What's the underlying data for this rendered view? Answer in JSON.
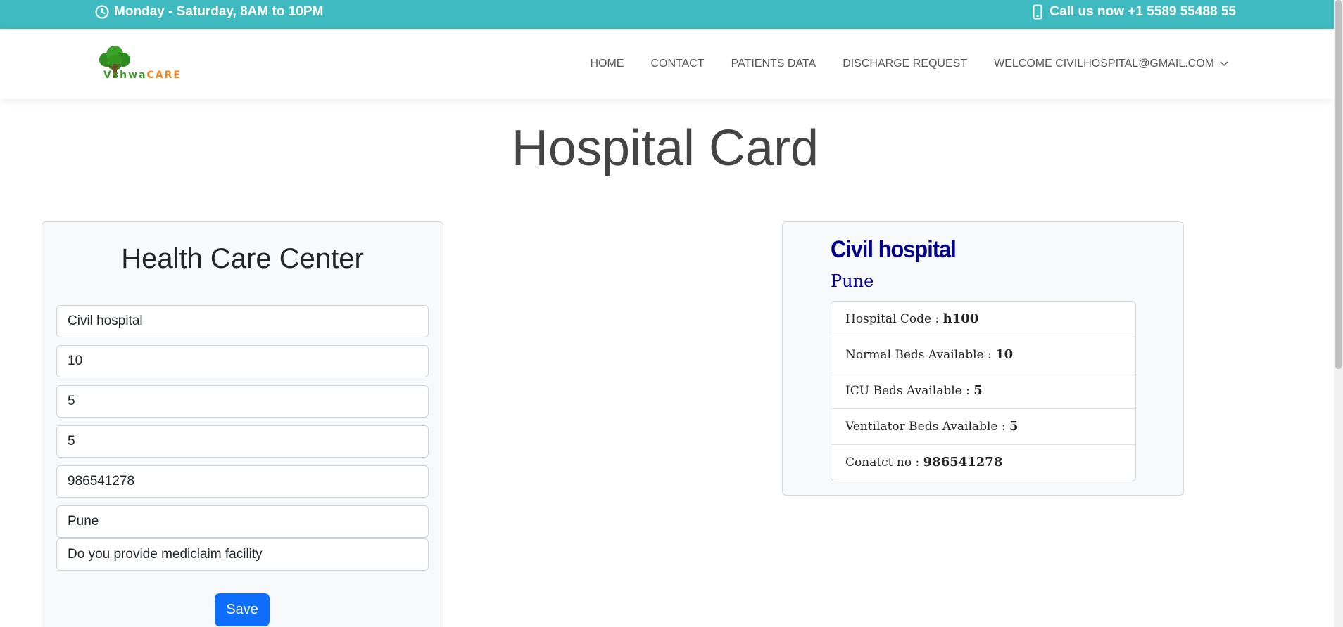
{
  "topbar": {
    "hours_text": "Monday - Saturday, 8AM to 10PM",
    "call_text": "Call us now +1 5589 55488 55",
    "icons": [
      "clock-icon",
      "phone-icon"
    ]
  },
  "brand": {
    "logo_letter": "V",
    "logo_text_middle": "shwa",
    "logo_text_end": "CARE"
  },
  "nav": {
    "home": "HOME",
    "contact": "CONTACT",
    "patients": "PATIENTS DATA",
    "discharge": "DISCHARGE REQUEST",
    "welcome": "WELCOME CIVILHOSPITAL@GMAIL.COM"
  },
  "page": {
    "title": "Hospital Card"
  },
  "form": {
    "heading": "Health Care Center",
    "fields": {
      "name": "Civil hospital",
      "normal_beds": "10",
      "icu_beds": "5",
      "ventilator_beds": "5",
      "contact": "986541278",
      "city": "Pune",
      "mediclaim_placeholder": "Do you provide mediclaim facility"
    },
    "save_label": "Save"
  },
  "card": {
    "name": "Civil hospital",
    "city": "Pune",
    "rows": [
      {
        "label": "Hospital Code : ",
        "value": "h100"
      },
      {
        "label": "Normal Beds Available : ",
        "value": "10"
      },
      {
        "label": "ICU Beds Available : ",
        "value": "5"
      },
      {
        "label": "Ventilator Beds Available : ",
        "value": "5"
      },
      {
        "label": "Conatct no : ",
        "value": "986541278"
      }
    ]
  },
  "colors": {
    "topbar": "#3ebac0",
    "primary_button": "#0d6efd",
    "card_title": "#00008b",
    "logo_green": "#3d9a2a",
    "logo_orange": "#f2841f"
  }
}
